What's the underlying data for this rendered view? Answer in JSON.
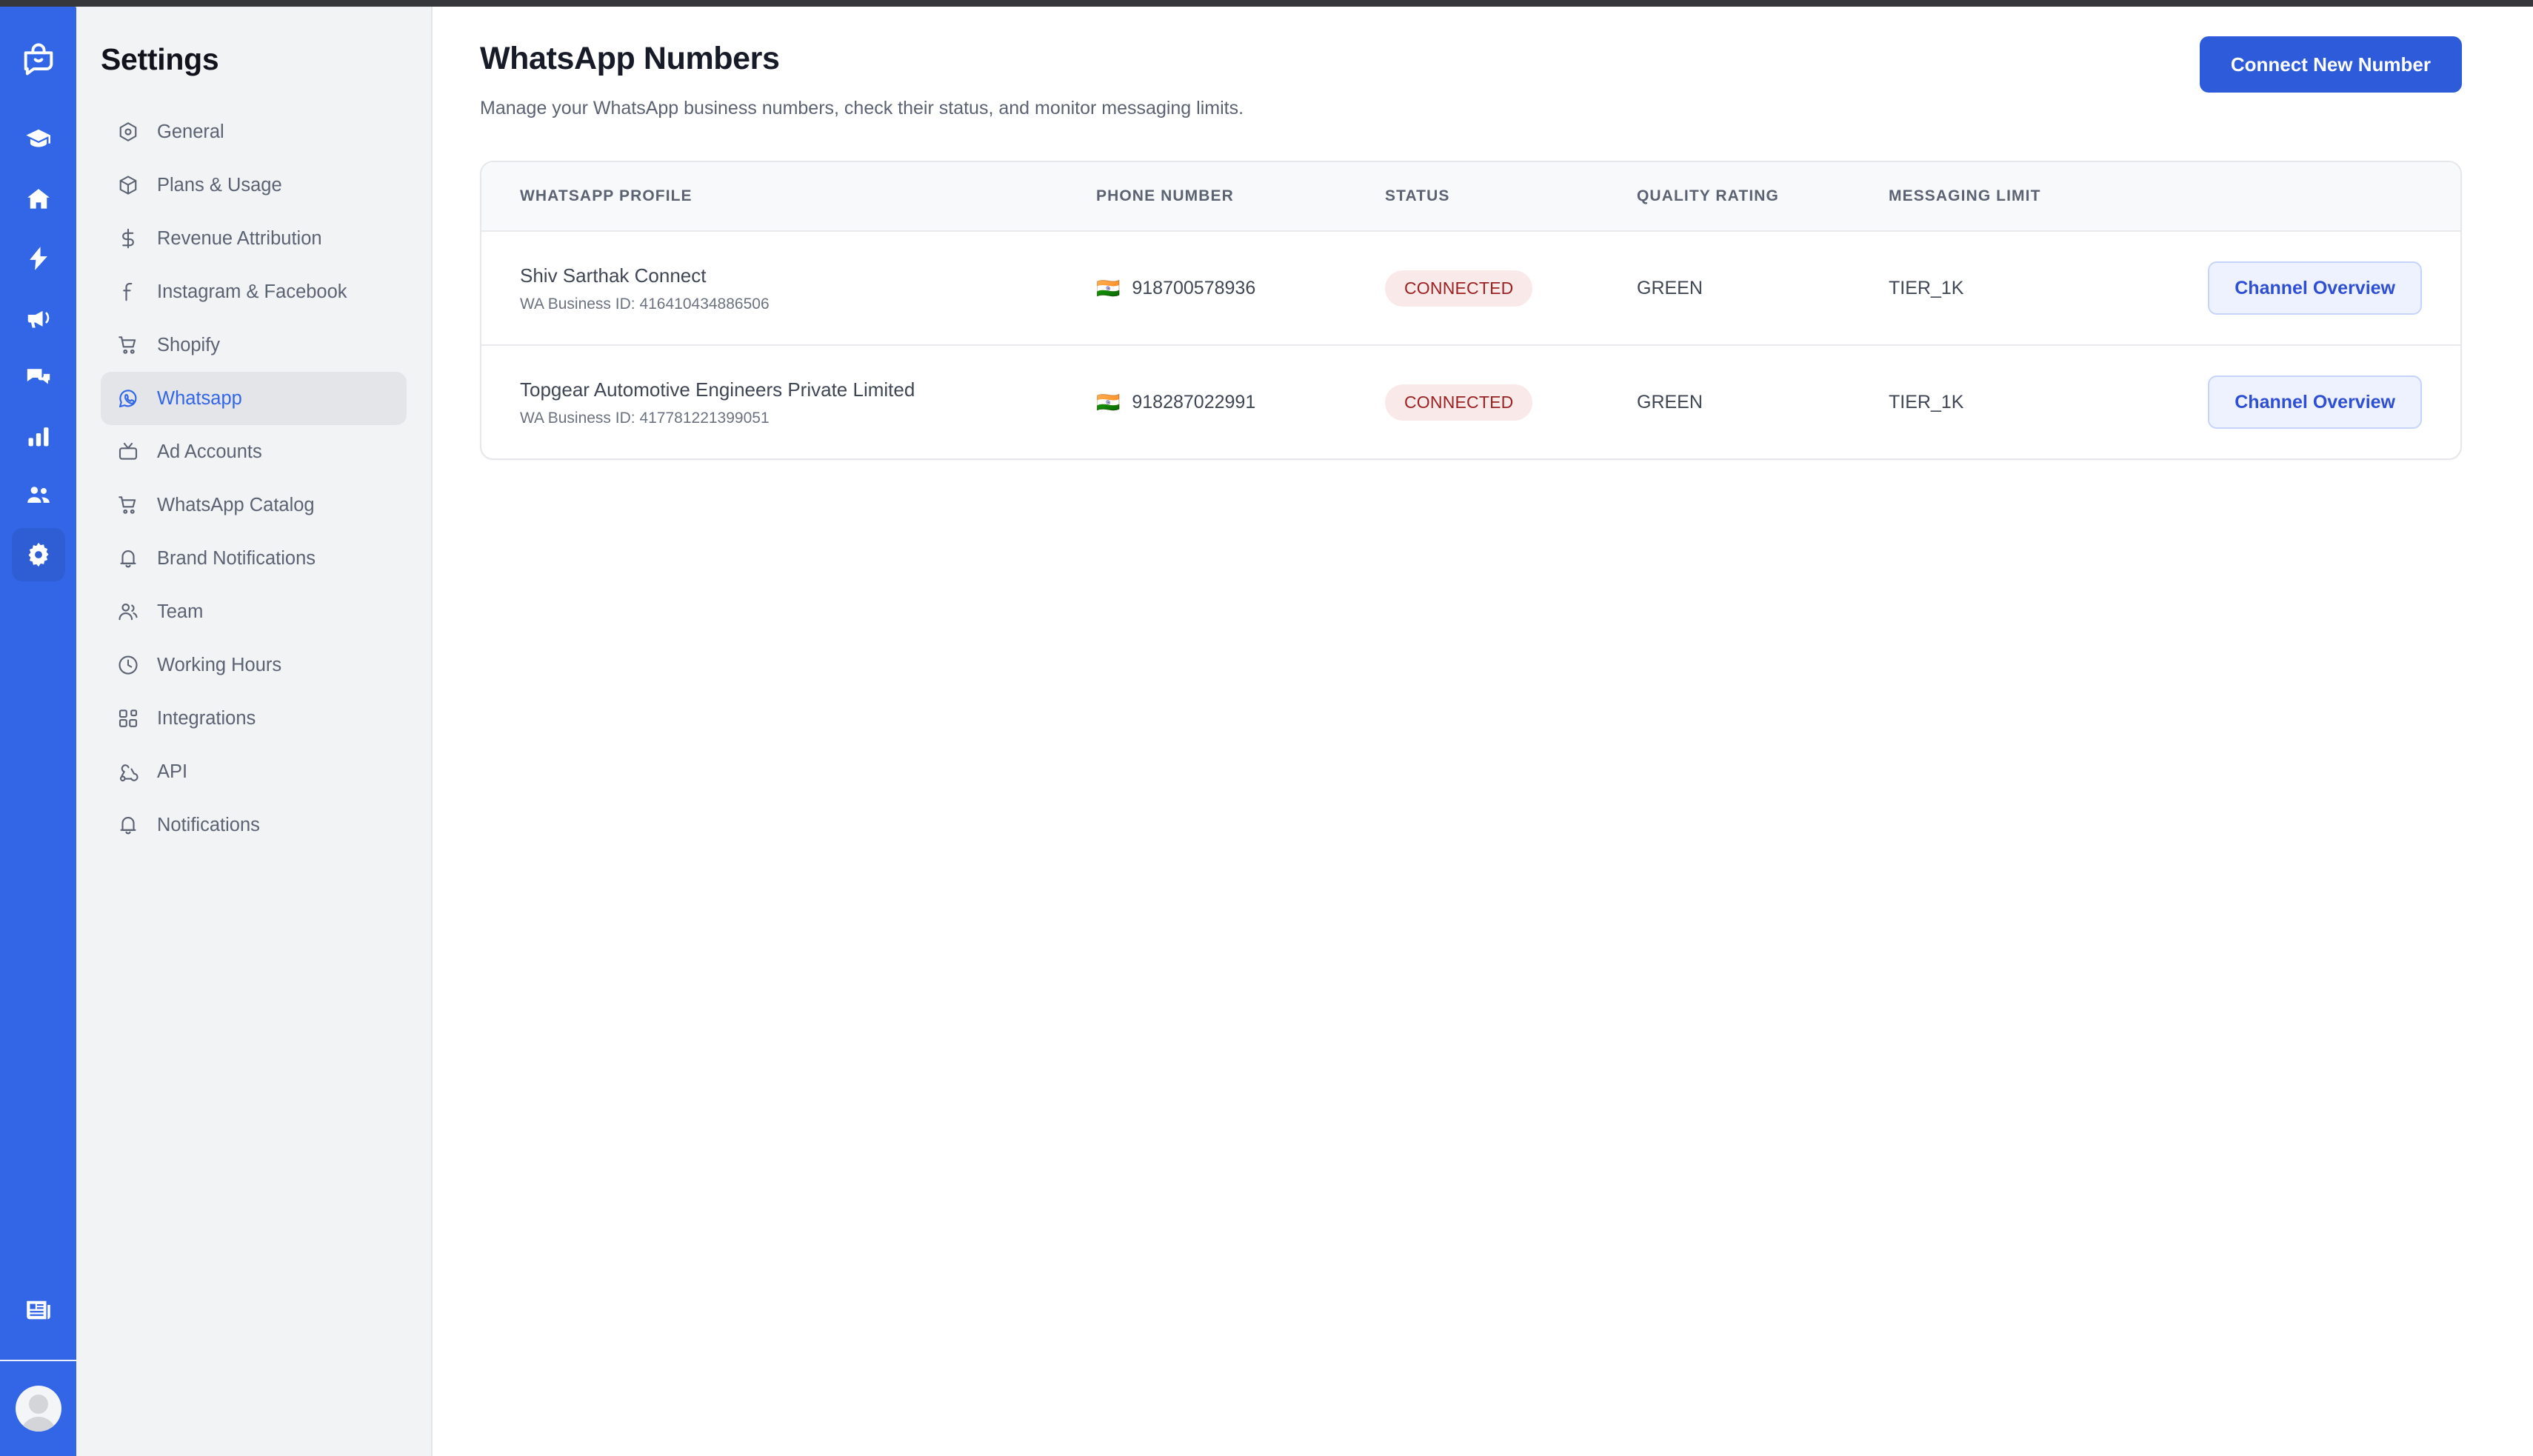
{
  "rail": {
    "logo": {
      "icon": "shop-chat-logo-icon",
      "label": "Brand Logo"
    },
    "items": [
      {
        "icon": "graduation-cap-icon",
        "label": "Learn",
        "active": false
      },
      {
        "icon": "home-icon",
        "label": "Home",
        "active": false
      },
      {
        "icon": "lightning-bolt-icon",
        "label": "Automations",
        "active": false
      },
      {
        "icon": "megaphone-icon",
        "label": "Campaigns",
        "active": false
      },
      {
        "icon": "chat-bubbles-icon",
        "label": "Inbox",
        "active": false
      },
      {
        "icon": "bar-chart-icon",
        "label": "Analytics",
        "active": false
      },
      {
        "icon": "users-icon",
        "label": "Audience",
        "active": false
      },
      {
        "icon": "gear-icon",
        "label": "Settings",
        "active": true
      }
    ],
    "bottom": [
      {
        "icon": "newspaper-icon",
        "label": "Whats New"
      },
      {
        "icon": "avatar",
        "label": "Account"
      }
    ]
  },
  "sidebar": {
    "title": "Settings",
    "items": [
      {
        "label": "General",
        "icon": "hexagon-target-icon",
        "active": false
      },
      {
        "label": "Plans & Usage",
        "icon": "package-box-icon",
        "active": false
      },
      {
        "label": "Revenue Attribution",
        "icon": "dollar-icon",
        "active": false
      },
      {
        "label": "Instagram & Facebook",
        "icon": "facebook-icon",
        "active": false
      },
      {
        "label": "Shopify",
        "icon": "shopping-cart-icon",
        "active": false
      },
      {
        "label": "Whatsapp",
        "icon": "whatsapp-icon",
        "active": true
      },
      {
        "label": "Ad Accounts",
        "icon": "tv-icon",
        "active": false
      },
      {
        "label": "WhatsApp Catalog",
        "icon": "shopping-cart-icon",
        "active": false
      },
      {
        "label": "Brand Notifications",
        "icon": "bell-icon",
        "active": false
      },
      {
        "label": "Team",
        "icon": "users-icon",
        "active": false
      },
      {
        "label": "Working Hours",
        "icon": "clock-icon",
        "active": false
      },
      {
        "label": "Integrations",
        "icon": "blocks-icon",
        "active": false
      },
      {
        "label": "API",
        "icon": "webhook-icon",
        "active": false
      },
      {
        "label": "Notifications",
        "icon": "bell-icon",
        "active": false
      }
    ]
  },
  "main": {
    "title": "WhatsApp Numbers",
    "subtitle": "Manage your WhatsApp business numbers, check their status, and monitor messaging limits.",
    "connect_button": "Connect New Number"
  },
  "table": {
    "columns": [
      "WHATSAPP PROFILE",
      "PHONE NUMBER",
      "STATUS",
      "QUALITY RATING",
      "MESSAGING LIMIT"
    ],
    "rows": [
      {
        "profile_name": "Shiv Sarthak Connect",
        "profile_id": "WA Business ID: 416410434886506",
        "flag": "🇮🇳",
        "phone": "918700578936",
        "status": "CONNECTED",
        "quality": "GREEN",
        "limit": "TIER_1K",
        "action": "Channel Overview"
      },
      {
        "profile_name": "Topgear Automotive Engineers Private Limited",
        "profile_id": "WA Business ID: 417781221399051",
        "flag": "🇮🇳",
        "phone": "918287022991",
        "status": "CONNECTED",
        "quality": "GREEN",
        "limit": "TIER_1K",
        "action": "Channel Overview"
      }
    ]
  },
  "colors": {
    "brand_blue": "#3366e6",
    "primary_button": "#2e5bd9",
    "active_nav_text": "#3366e6",
    "badge_bg": "#fae9e9",
    "badge_text": "#9b2222",
    "ghost_button_bg": "#eef2fe",
    "ghost_button_text": "#2e4fd4",
    "sidebar_bg": "#f2f3f5",
    "page_bg": "#ffffff"
  }
}
